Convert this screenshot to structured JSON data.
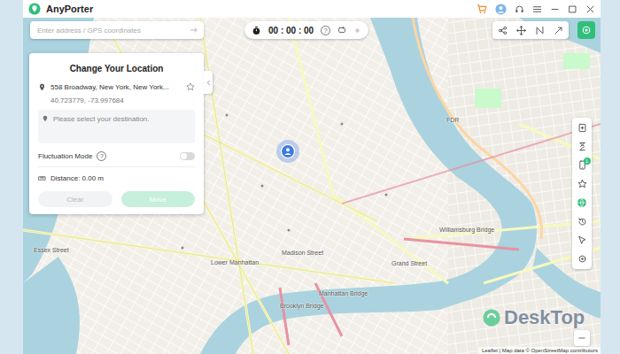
{
  "window": {
    "title": "AnyPorter"
  },
  "search": {
    "placeholder": "Enter address / GPS coordinates"
  },
  "timer": {
    "time": "00 : 00 : 00",
    "help": "?"
  },
  "panel": {
    "title": "Change Your Location",
    "address": "558 Broadway, New York, New York...",
    "coords": "40.723779, -73.997684",
    "destination_placeholder": "Please select your destination.",
    "fluctuation": {
      "label": "Fluctuation Mode",
      "help": "?",
      "on": false
    },
    "distance": "Distance: 0.00 m",
    "buttons": [
      {
        "label": "Clear",
        "disabled": true
      },
      {
        "label": "Move",
        "disabled": true
      }
    ]
  },
  "right_toolbar": {
    "badge": "1"
  },
  "map": {
    "labels": [
      "Lower Manhattan",
      "Williamsburg Bridge",
      "Manhattan Bridge",
      "Brooklyn Bridge",
      "Madison Street",
      "FDR",
      "Essex Street",
      "Grand Street"
    ],
    "attribution": "Leaflet | Map data © OpenStreetMap contributors"
  },
  "watermark": "DeskTop"
}
